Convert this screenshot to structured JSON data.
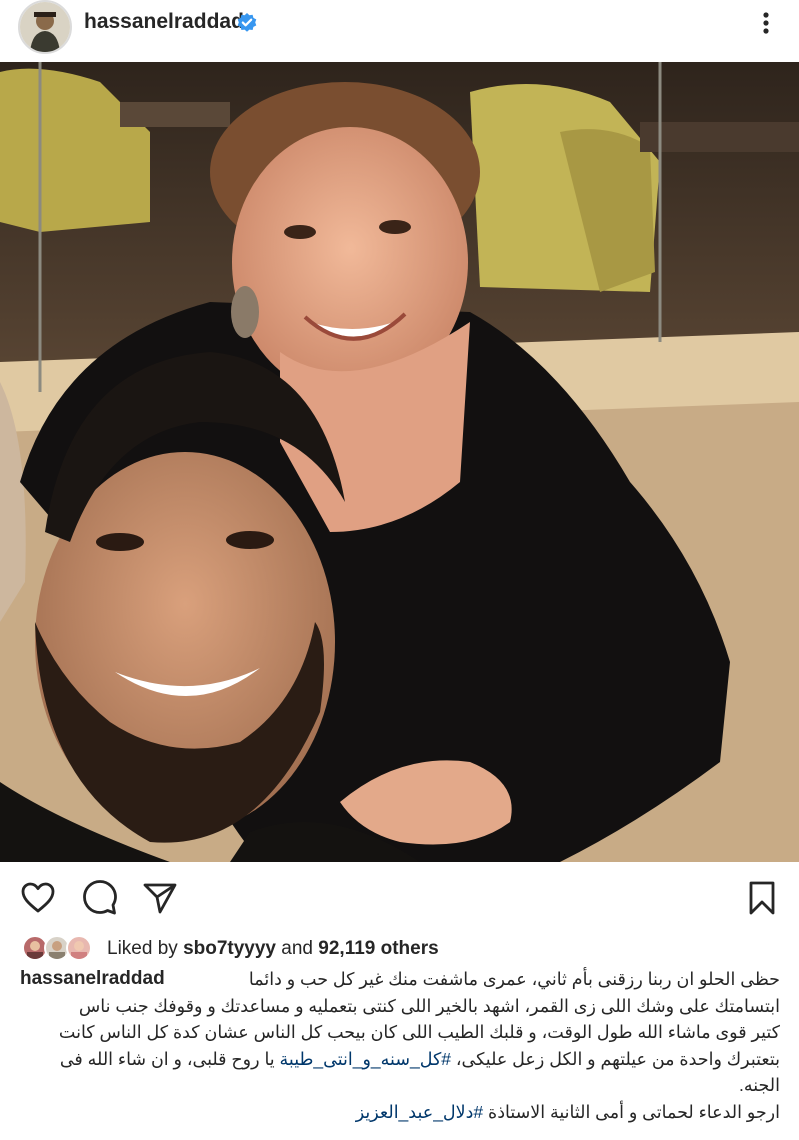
{
  "post": {
    "username": "hassanelraddad",
    "verified": true,
    "icons": {
      "verified": "verified-badge-icon",
      "more": "more-vertical-icon",
      "like": "heart-icon",
      "comment": "comment-icon",
      "share": "send-icon",
      "save": "bookmark-icon"
    },
    "colors": {
      "verified": "#3897f0",
      "hashtag": "#00376b",
      "text": "#262626"
    }
  },
  "likes": {
    "prefix": "Liked by",
    "liker": "sbo7tyyyy",
    "conjunction": "and",
    "count": "92,119 others"
  },
  "caption": {
    "line1": "حظى الحلو ان ربنا رزقنى بأم ثاني، عمرى ماشفت منك غير كل حب و دائما",
    "line2": "ابتسامتك على وشك اللى زى القمر، اشهد بالخير اللى كنتى بتعمليه و مساعدتك و وقوفك جنب ناس",
    "line3": "كتير قوى ماشاء الله طول الوقت، و قلبك الطيب اللى كان بيحب كل الناس عشان كدة كل الناس كانت",
    "line4_before": "بتعتبرك واحدة من عيلتهم و الكل زعل عليكى،",
    "line4_tag": "#كل_سنه_و_انتى_طيبة",
    "line4_after": "يا روح قلبى، و ان شاء الله فى",
    "line5": "الجنه.",
    "line6_before": "ارجو الدعاء لحماتى و أمى الثانية الاستاذة",
    "line6_tag": "#دلال_عبد_العزيز"
  }
}
